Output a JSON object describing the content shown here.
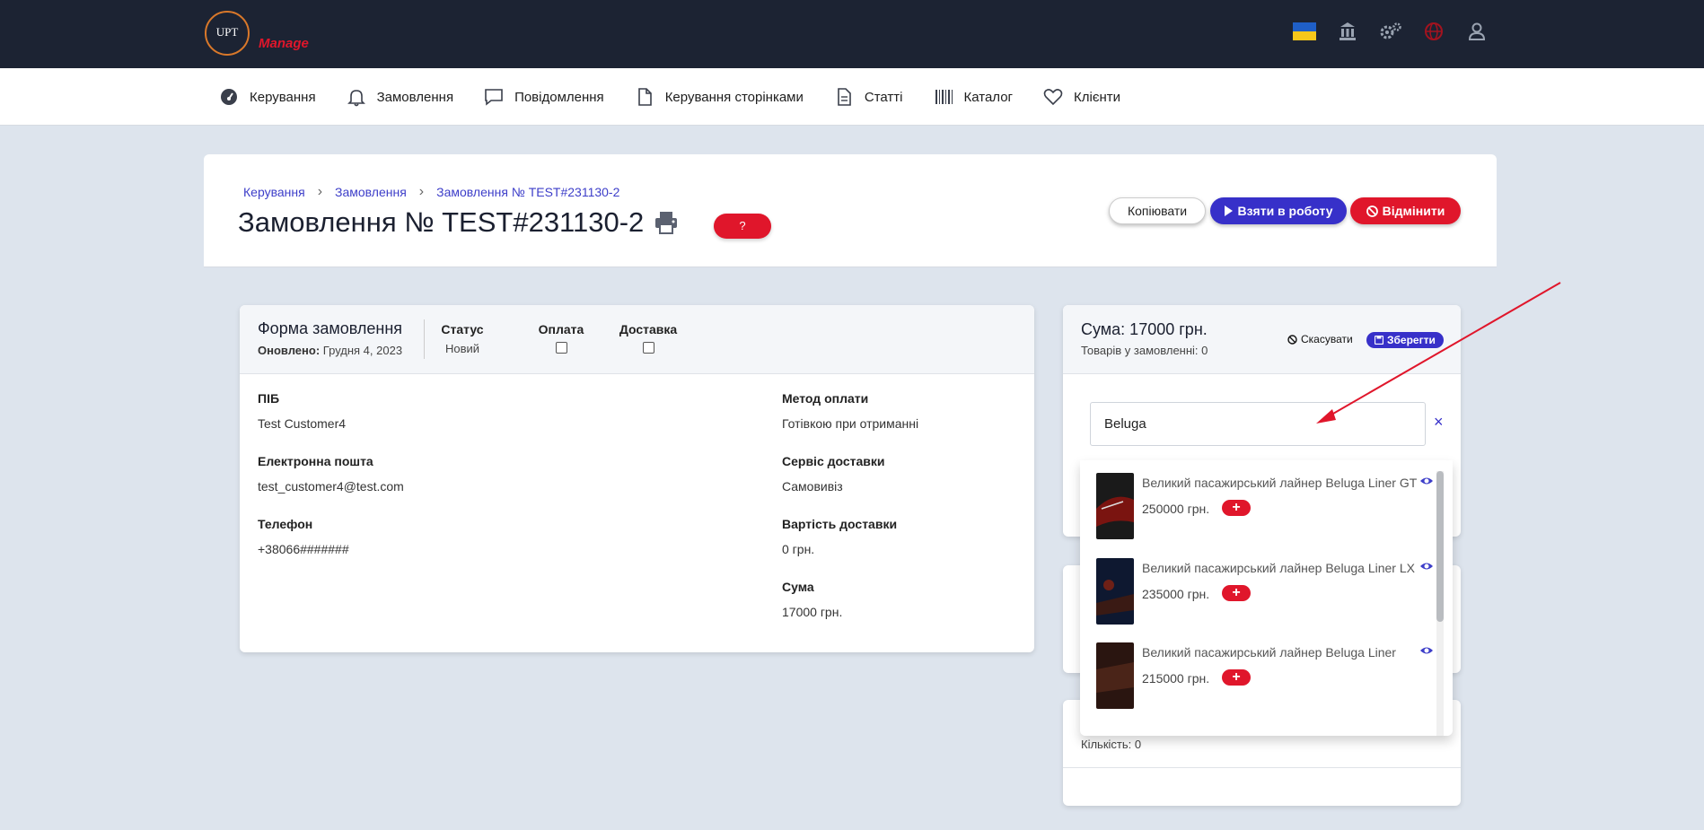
{
  "logo": {
    "text": "UPT",
    "manage": "Manage"
  },
  "nav": [
    {
      "label": "Керування",
      "icon": "dashboard-icon"
    },
    {
      "label": "Замовлення",
      "icon": "bell-icon"
    },
    {
      "label": "Повідомлення",
      "icon": "chat-icon"
    },
    {
      "label": "Керування сторінками",
      "icon": "file-icon"
    },
    {
      "label": "Статті",
      "icon": "document-icon"
    },
    {
      "label": "Каталог",
      "icon": "barcode-icon"
    },
    {
      "label": "Клієнти",
      "icon": "heart-icon"
    }
  ],
  "breadcrumb": [
    "Керування",
    "Замовлення",
    "Замовлення № TEST#231130-2"
  ],
  "page_title": "Замовлення № TEST#231130-2",
  "help_label": "?",
  "actions": {
    "copy": "Копіювати",
    "take": "Взяти в роботу",
    "cancel": "Відмінити"
  },
  "form": {
    "title": "Форма замовлення",
    "updated_label": "Оновлено:",
    "updated_value": "Грудня 4, 2023",
    "status_label": "Статус",
    "status_value": "Новий",
    "payment_label": "Оплата",
    "delivery_label": "Доставка",
    "fio_label": "ПІБ",
    "fio_value": "Test Customer4",
    "email_label": "Електронна пошта",
    "email_value": "test_customer4@test.com",
    "phone_label": "Телефон",
    "phone_value": "+38066#######",
    "pay_method_label": "Метод оплати",
    "pay_method_value": "Готівкою при отриманні",
    "delivery_service_label": "Сервіс доставки",
    "delivery_service_value": "Самовивіз",
    "delivery_cost_label": "Вартість доставки",
    "delivery_cost_value": "0 грн.",
    "sum_label": "Сума",
    "sum_value": "17000 грн."
  },
  "summary": {
    "title": "Сума: 17000 грн.",
    "count": "Товарів у замовленні: 0",
    "cancel": "Скасувати",
    "save": "Зберегти",
    "qty": "Кількість: 0"
  },
  "search": {
    "value": "Beluga",
    "clear": "×",
    "results": [
      {
        "name": "Великий пасажирський лайнер Beluga Liner GT",
        "price": "250000 грн.",
        "add": "+"
      },
      {
        "name": "Великий пасажирський лайнер Beluga Liner LX",
        "price": "235000 грн.",
        "add": "+"
      },
      {
        "name": "Великий пасажирський лайнер Beluga Liner",
        "price": "215000 грн.",
        "add": "+"
      }
    ]
  },
  "colors": {
    "accent": "#3730c9",
    "danger": "#e0162b",
    "topbar": "#1c2333",
    "annotation_arrow": "#e0162b"
  }
}
